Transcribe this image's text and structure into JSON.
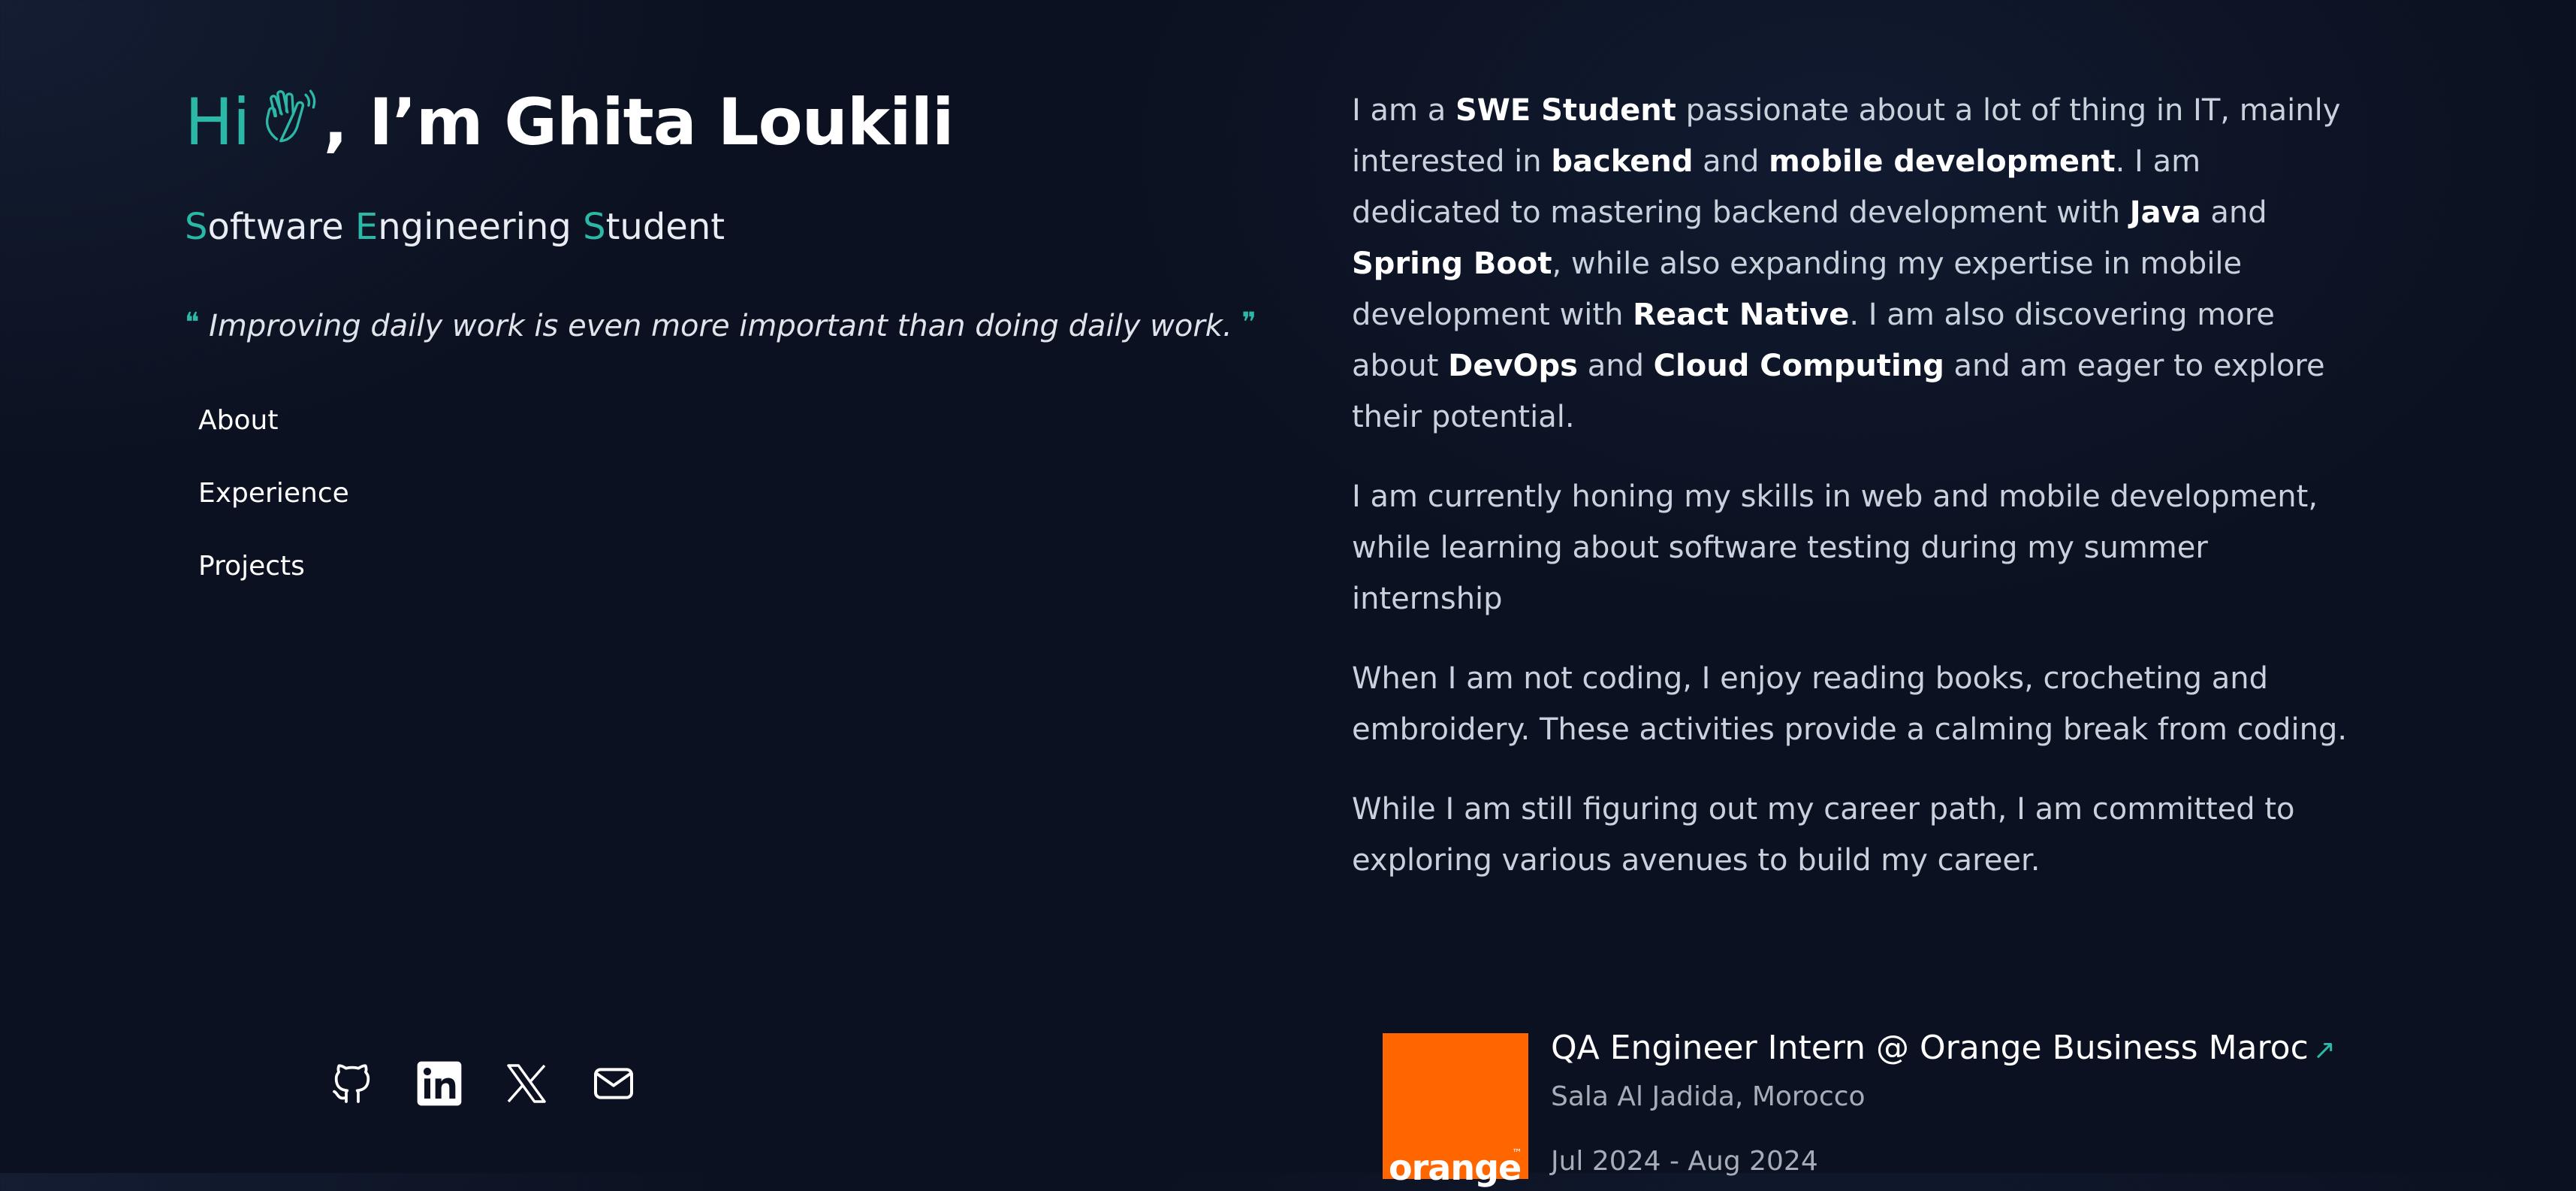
{
  "hero": {
    "greeting": "Hi",
    "greeting_icon": "waving-hand-icon",
    "name_text": ", I’m Ghita Loukili",
    "subtitle": {
      "word1_initial": "S",
      "word1_rest": "oftware",
      "word2_initial": "E",
      "word2_rest": "ngineering",
      "word3_initial": "S",
      "word3_rest": "tudent"
    },
    "quote": "Improving daily work  is even more important than doing daily work.",
    "quote_open": "❝",
    "quote_close": "❞"
  },
  "nav": {
    "items": [
      {
        "label": "About"
      },
      {
        "label": "Experience"
      },
      {
        "label": "Projects"
      }
    ]
  },
  "socials": [
    {
      "icon": "github-icon"
    },
    {
      "icon": "linkedin-icon"
    },
    {
      "icon": "x-icon"
    },
    {
      "icon": "mail-icon"
    }
  ],
  "about": {
    "p1": {
      "t1": "I am a ",
      "b1": "SWE Student",
      "t2": " passionate about a lot of thing in IT, mainly interested in ",
      "b2": "backend",
      "t3": " and ",
      "b3": "mobile development",
      "t4": ". I am dedicated to mastering backend development with ",
      "b4": "Java",
      "t5": " and ",
      "b5": "Spring Boot",
      "t6": ", while also expanding my expertise in mobile development with ",
      "b6": "React Native",
      "t7": ". I am also discovering more about ",
      "b7": "DevOps",
      "t8": " and ",
      "b8": "Cloud Computing",
      "t9": " and am eager to explore their potential."
    },
    "p2": "I am currently honing my skills in web and mobile development, while learning about software testing during my summer internship",
    "p3": "When I am not coding, I enjoy reading books, crocheting and embroidery. These activities provide a calming break from coding.",
    "p4": "While I am still figuring out my career path, I am committed to exploring various avenues to build my career."
  },
  "experience": {
    "title": "QA Engineer Intern @ Orange Business Maroc",
    "arrow": "↗",
    "location": "Sala Al Jadida, Morocco",
    "dates": "Jul 2024 - Aug 2024",
    "logo_text": "orange",
    "logo_tm": "™",
    "logo_color": "#ff6600"
  },
  "theme": {
    "accent": "#2bb8a6",
    "background": "#0b1120"
  }
}
